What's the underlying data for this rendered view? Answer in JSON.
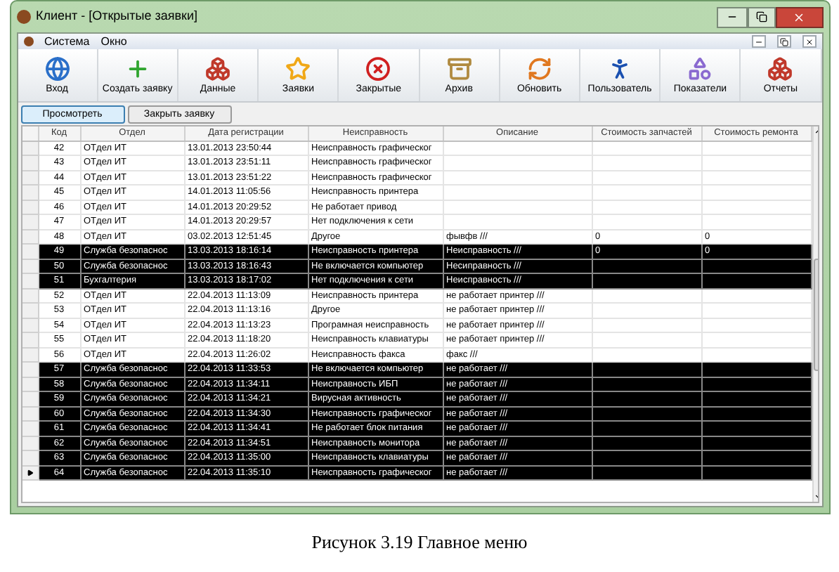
{
  "window": {
    "title": "Клиент - [Открытые заявки]"
  },
  "menu": [
    "Система",
    "Окно"
  ],
  "toolbar": [
    {
      "kind": "globe",
      "label": "Вход"
    },
    {
      "kind": "plus",
      "label": "Создать заявку"
    },
    {
      "kind": "cubes",
      "label": "Данные"
    },
    {
      "kind": "star",
      "label": "Заявки"
    },
    {
      "kind": "close",
      "label": "Закрытые"
    },
    {
      "kind": "archive",
      "label": "Архив"
    },
    {
      "kind": "refresh",
      "label": "Обновить"
    },
    {
      "kind": "user",
      "label": "Пользователь"
    },
    {
      "kind": "shapes",
      "label": "Показатели"
    },
    {
      "kind": "cubes",
      "label": "Отчеты"
    }
  ],
  "actions": [
    {
      "label": "Просмотреть",
      "selected": true
    },
    {
      "label": "Закрыть заявку",
      "selected": false
    }
  ],
  "table": {
    "columns": [
      "Код",
      "Отдел",
      "Дата регистрации",
      "Неисправность",
      "Описание",
      "Стоимость запчастей",
      "Стоимость ремонта"
    ],
    "rows": [
      {
        "code": "42",
        "dept": "ОТдел ИТ",
        "date": "13.01.2013 23:50:44",
        "fault": "Неисправность графическог",
        "selected": false,
        "current": false
      },
      {
        "code": "43",
        "dept": "ОТдел ИТ",
        "date": "13.01.2013 23:51:11",
        "fault": "Неисправность графическог",
        "selected": false,
        "current": false
      },
      {
        "code": "44",
        "dept": "ОТдел ИТ",
        "date": "13.01.2013 23:51:22",
        "fault": "Неисправность графическог",
        "selected": false,
        "current": false
      },
      {
        "code": "45",
        "dept": "ОТдел ИТ",
        "date": "14.01.2013 11:05:56",
        "fault": "Неисправность принтера",
        "selected": false,
        "current": false
      },
      {
        "code": "46",
        "dept": "ОТдел ИТ",
        "date": "14.01.2013 20:29:52",
        "fault": "Не работает привод",
        "selected": false,
        "current": false
      },
      {
        "code": "47",
        "dept": "ОТдел ИТ",
        "date": "14.01.2013 20:29:57",
        "fault": "Нет подключения к сети",
        "selected": false,
        "current": false
      },
      {
        "code": "48",
        "dept": "ОТдел ИТ",
        "date": "03.02.2013 12:51:45",
        "fault": "Другое",
        "desc": "фывфв ///",
        "parts": "0",
        "repair": "0",
        "selected": false,
        "current": false
      },
      {
        "code": "49",
        "dept": "Служба безопаснос",
        "date": "13.03.2013 18:16:14",
        "fault": "Неисправность принтера",
        "desc": "Неисправность ///",
        "parts": "0",
        "repair": "0",
        "selected": true,
        "current": false
      },
      {
        "code": "50",
        "dept": "Служба безопаснос",
        "date": "13.03.2013 18:16:43",
        "fault": "Не включается компьютер",
        "desc": "Несиправность ///",
        "selected": true,
        "current": false
      },
      {
        "code": "51",
        "dept": "Бухгалтерия",
        "date": "13.03.2013 18:17:02",
        "fault": "Нет подключения к сети",
        "desc": "Неисправность ///",
        "selected": true,
        "current": false
      },
      {
        "code": "52",
        "dept": "ОТдел ИТ",
        "date": "22.04.2013 11:13:09",
        "fault": "Неисправность принтера",
        "desc": "не работает принтер ///",
        "selected": false,
        "current": false
      },
      {
        "code": "53",
        "dept": "ОТдел ИТ",
        "date": "22.04.2013 11:13:16",
        "fault": "Другое",
        "desc": "не работает принтер ///",
        "selected": false,
        "current": false
      },
      {
        "code": "54",
        "dept": "ОТдел ИТ",
        "date": "22.04.2013 11:13:23",
        "fault": "Програмная неисправность",
        "desc": "не работает принтер ///",
        "selected": false,
        "current": false
      },
      {
        "code": "55",
        "dept": "ОТдел ИТ",
        "date": "22.04.2013 11:18:20",
        "fault": "Неисправность клавиатуры",
        "desc": "не работает принтер ///",
        "selected": false,
        "current": false
      },
      {
        "code": "56",
        "dept": "ОТдел ИТ",
        "date": "22.04.2013 11:26:02",
        "fault": "Неисправность факса",
        "desc": "факс ///",
        "selected": false,
        "current": false
      },
      {
        "code": "57",
        "dept": "Служба безопаснос",
        "date": "22.04.2013 11:33:53",
        "fault": "Не включается компьютер",
        "desc": "не работает ///",
        "selected": true,
        "current": false
      },
      {
        "code": "58",
        "dept": "Служба безопаснос",
        "date": "22.04.2013 11:34:11",
        "fault": "Неисправность ИБП",
        "desc": "не работает ///",
        "selected": true,
        "current": false
      },
      {
        "code": "59",
        "dept": "Служба безопаснос",
        "date": "22.04.2013 11:34:21",
        "fault": "Вирусная активность",
        "desc": "не работает ///",
        "selected": true,
        "current": false
      },
      {
        "code": "60",
        "dept": "Служба безопаснос",
        "date": "22.04.2013 11:34:30",
        "fault": "Неисправность графическог",
        "desc": "не работает ///",
        "selected": true,
        "current": false
      },
      {
        "code": "61",
        "dept": "Служба безопаснос",
        "date": "22.04.2013 11:34:41",
        "fault": "Не работает блок питания",
        "desc": "не работает ///",
        "selected": true,
        "current": false
      },
      {
        "code": "62",
        "dept": "Служба безопаснос",
        "date": "22.04.2013 11:34:51",
        "fault": "Неисправность монитора",
        "desc": "не работает ///",
        "selected": true,
        "current": false
      },
      {
        "code": "63",
        "dept": "Служба безопаснос",
        "date": "22.04.2013 11:35:00",
        "fault": "Неисправность клавиатуры",
        "desc": "не работает ///",
        "selected": true,
        "current": false
      },
      {
        "code": "64",
        "dept": "Служба безопаснос",
        "date": "22.04.2013 11:35:10",
        "fault": "Неисправность графическог",
        "desc": "не работает ///",
        "selected": true,
        "current": true
      }
    ]
  },
  "caption": "Рисунок 3.19 Главное меню"
}
